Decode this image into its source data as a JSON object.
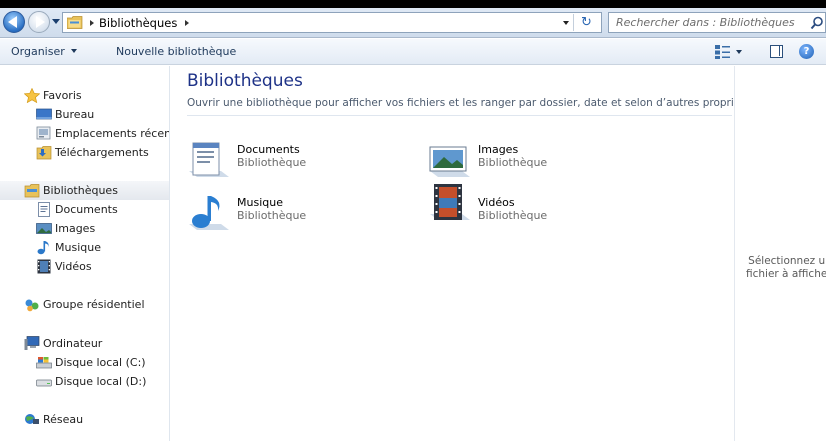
{
  "address": {
    "crumb": "Bibliothèques",
    "search_placeholder": "Rechercher dans : Bibliothèques"
  },
  "toolbar": {
    "organize_label": "Organiser",
    "new_library_label": "Nouvelle bibliothèque",
    "help_label": "?"
  },
  "sidebar": {
    "favorites": {
      "label": "Favoris",
      "icon": "star-icon"
    },
    "favorites_items": [
      {
        "label": "Bureau",
        "icon": "desktop-icon"
      },
      {
        "label": "Emplacements récents",
        "icon": "recent-places-icon"
      },
      {
        "label": "Téléchargements",
        "icon": "downloads-icon"
      }
    ],
    "libraries": {
      "label": "Bibliothèques",
      "icon": "libraries-icon"
    },
    "libraries_items": [
      {
        "label": "Documents",
        "icon": "documents-icon"
      },
      {
        "label": "Images",
        "icon": "images-icon"
      },
      {
        "label": "Musique",
        "icon": "music-icon"
      },
      {
        "label": "Vidéos",
        "icon": "videos-icon"
      }
    ],
    "homegroup": {
      "label": "Groupe résidentiel",
      "icon": "homegroup-icon"
    },
    "computer": {
      "label": "Ordinateur",
      "icon": "computer-icon"
    },
    "computer_items": [
      {
        "label": "Disque local (C:)",
        "icon": "drive-c-icon"
      },
      {
        "label": "Disque local (D:)",
        "icon": "drive-d-icon"
      }
    ],
    "network": {
      "label": "Réseau",
      "icon": "network-icon"
    }
  },
  "main": {
    "title": "Bibliothèques",
    "subtitle": "Ouvrir une bibliothèque pour afficher vos fichiers et les ranger par dossier, date et selon d’autres propriétés",
    "libraries": [
      {
        "name": "Documents",
        "type": "Bibliothèque",
        "icon": "documents-icon"
      },
      {
        "name": "Images",
        "type": "Bibliothèque",
        "icon": "images-icon"
      },
      {
        "name": "Musique",
        "type": "Bibliothèque",
        "icon": "music-icon"
      },
      {
        "name": "Vidéos",
        "type": "Bibliothèque",
        "icon": "videos-icon"
      }
    ]
  },
  "preview": {
    "message": "Sélectionnez un fichier à afficher."
  },
  "colors": {
    "title": "#1e3287",
    "selected_bg": "#e4e8ee",
    "toolbar_text": "#1e395b"
  }
}
